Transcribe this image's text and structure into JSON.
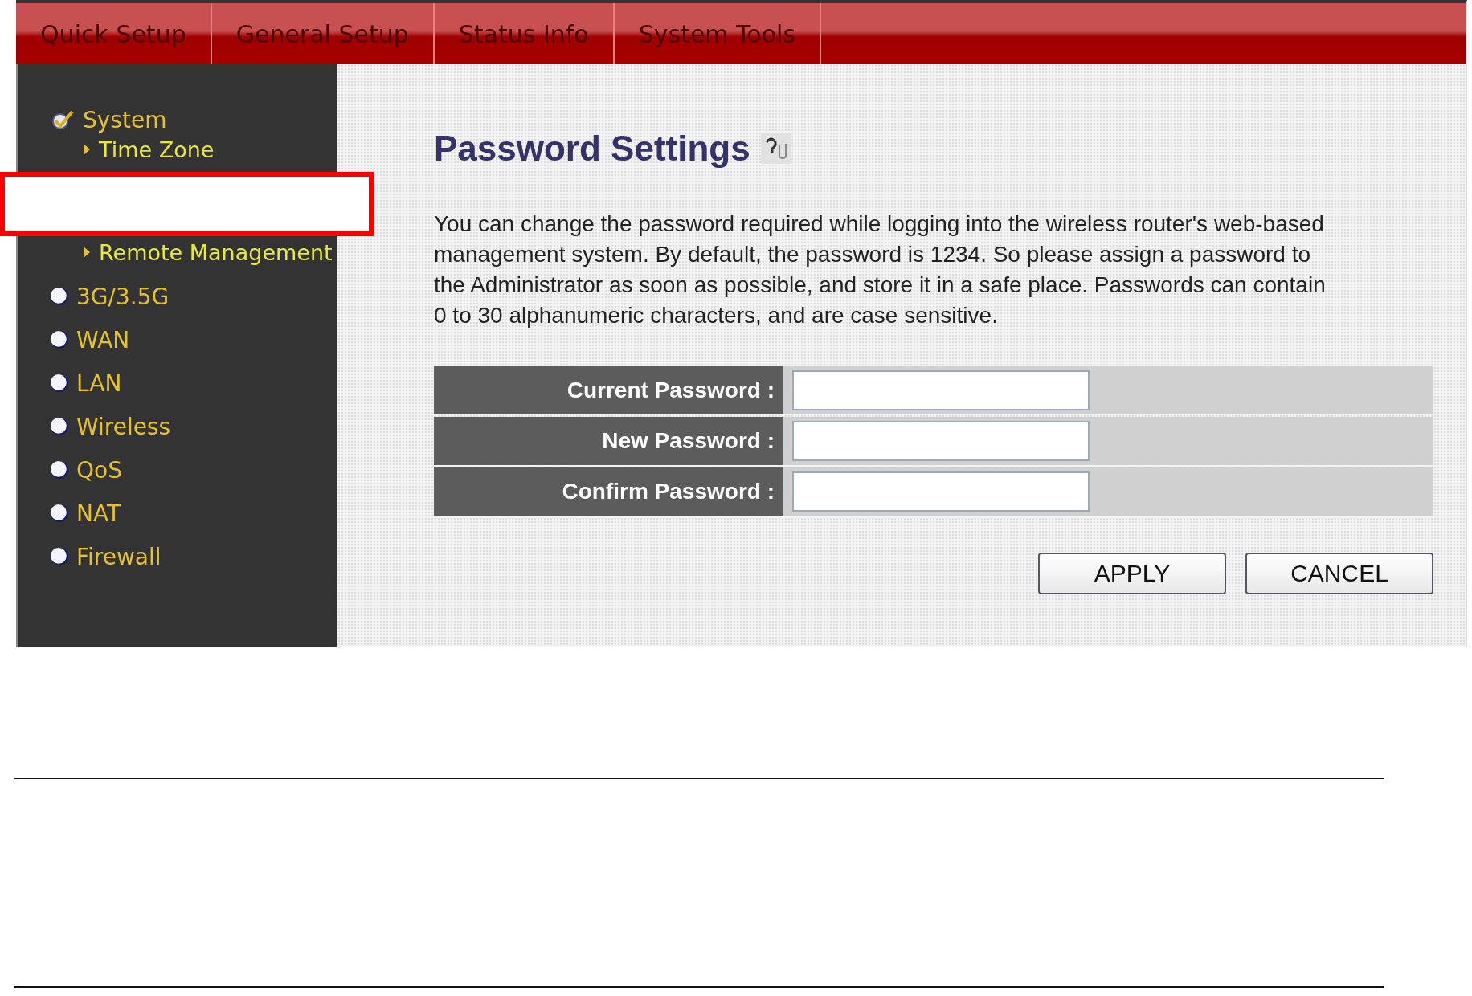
{
  "tabs": [
    {
      "label": "Quick Setup"
    },
    {
      "label": "General Setup"
    },
    {
      "label": "Status Info"
    },
    {
      "label": "System Tools"
    }
  ],
  "sidebar": {
    "items": [
      {
        "label": "System",
        "kind": "section",
        "expanded": true,
        "children": [
          {
            "label": "Time Zone"
          },
          {
            "label": "Remote Management"
          }
        ]
      },
      {
        "label": "3G/3.5G",
        "kind": "section",
        "expanded": false
      },
      {
        "label": "WAN",
        "kind": "section",
        "expanded": false
      },
      {
        "label": "LAN",
        "kind": "section",
        "expanded": false
      },
      {
        "label": "Wireless",
        "kind": "section",
        "expanded": false
      },
      {
        "label": "QoS",
        "kind": "section",
        "expanded": false
      },
      {
        "label": "NAT",
        "kind": "section",
        "expanded": false
      },
      {
        "label": "Firewall",
        "kind": "section",
        "expanded": false
      }
    ]
  },
  "content": {
    "title": "Password Settings",
    "description": "You can change the password required while logging into the wireless router's web-based management system. By default, the password is 1234. So please assign a password to the Administrator as soon as possible, and store it in a safe place. Passwords can contain 0 to 30 alphanumeric characters, and are case sensitive.",
    "fields": [
      {
        "label": "Current Password :"
      },
      {
        "label": "New Password :"
      },
      {
        "label": "Confirm Password :"
      }
    ],
    "buttons": [
      "APPLY",
      "CANCEL"
    ]
  }
}
